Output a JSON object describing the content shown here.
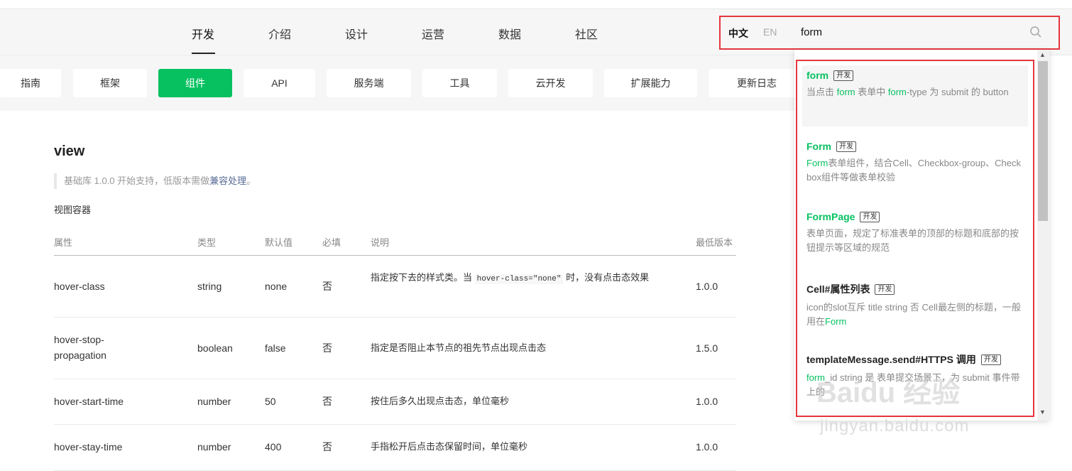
{
  "nav": {
    "items": [
      {
        "label": "开发",
        "active": true
      },
      {
        "label": "介绍"
      },
      {
        "label": "设计"
      },
      {
        "label": "运营"
      },
      {
        "label": "数据"
      },
      {
        "label": "社区"
      }
    ]
  },
  "lang": {
    "zh": "中文",
    "en": "EN"
  },
  "search": {
    "value": "form",
    "icon": "search-icon"
  },
  "tabs": [
    "指南",
    "框架",
    "组件",
    "API",
    "服务端",
    "工具",
    "云开发",
    "扩展能力",
    "更新日志"
  ],
  "active_tab": "组件",
  "page": {
    "title": "view",
    "note_prefix": "基础库 1.0.0 开始支持，低版本需做",
    "note_link": "兼容处理",
    "note_suffix": "。",
    "subtitle": "视图容器"
  },
  "table": {
    "headers": [
      "属性",
      "类型",
      "默认值",
      "必填",
      "说明",
      "最低版本"
    ],
    "rows": [
      {
        "attr": "hover-class",
        "type": "string",
        "default": "none",
        "required": "否",
        "desc_before": "指定按下去的样式类。当 ",
        "desc_code": "hover-class=\"none\"",
        "desc_after": " 时，没有点击态效果",
        "version": "1.0.0"
      },
      {
        "attr": "hover-stop-propagation",
        "type": "boolean",
        "default": "false",
        "required": "否",
        "desc": "指定是否阻止本节点的祖先节点出现点击态",
        "version": "1.5.0"
      },
      {
        "attr": "hover-start-time",
        "type": "number",
        "default": "50",
        "required": "否",
        "desc": "按住后多久出现点击态，单位毫秒",
        "version": "1.0.0"
      },
      {
        "attr": "hover-stay-time",
        "type": "number",
        "default": "400",
        "required": "否",
        "desc": "手指松开后点击态保留时间，单位毫秒",
        "version": "1.0.0"
      }
    ]
  },
  "results": [
    {
      "title": "form",
      "badge": "开发",
      "title_green": true,
      "d1": "当点击 ",
      "g1": "form",
      "d2": " 表单中 ",
      "g2": "form",
      "d3": "-type 为 submit 的 button"
    },
    {
      "title": "Form",
      "badge": "开发",
      "title_green": true,
      "g1": "Form",
      "d1": "表单组件，结合Cell、Checkbox-group、Checkbox组件等做表单校验"
    },
    {
      "title": "FormPage",
      "badge": "开发",
      "title_green": true,
      "d1": "表单页面，规定了标准表单的顶部的标题和底部的按钮提示等区域的规范"
    },
    {
      "title": "Cell#属性列表",
      "badge": "开发",
      "title_green": false,
      "d1": "icon的slot互斥 title string 否 Cell最左侧的标题，一般用在",
      "g1": "Form"
    },
    {
      "title": "templateMessage.send#HTTPS 调用",
      "badge": "开发",
      "title_green": false,
      "g1": "form",
      "d1": "_id string 是 表单提交场景下，为 submit 事件带上的"
    }
  ],
  "watermark": {
    "line1": "Baidu 经验",
    "line2": "jingyan.baidu.com"
  },
  "colors": {
    "accent": "#07c160",
    "highlight_box": "#e5363f",
    "link": "#576b95"
  }
}
